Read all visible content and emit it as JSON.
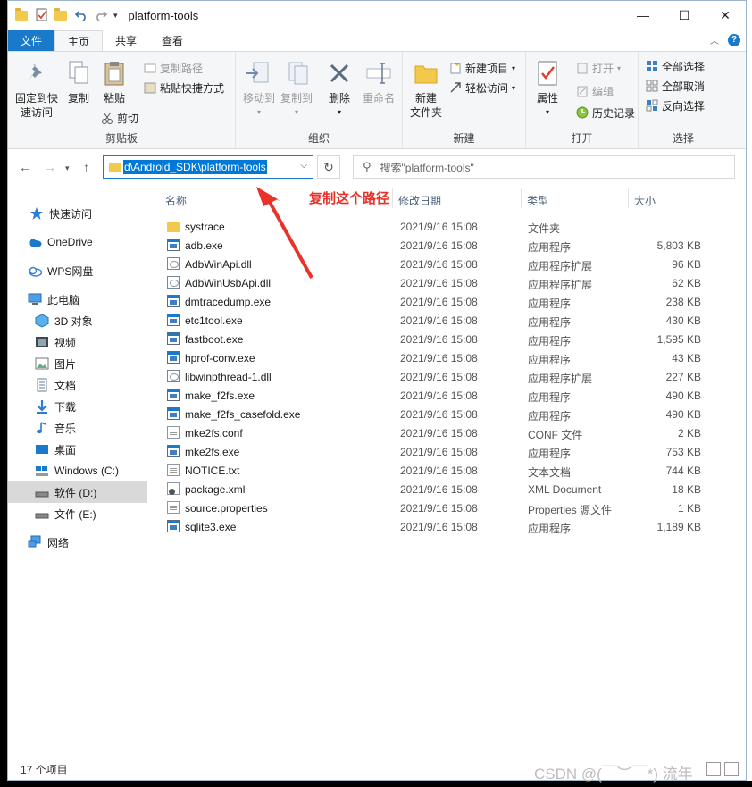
{
  "window": {
    "title": "platform-tools",
    "controls": [
      "—",
      "☐",
      "✕"
    ]
  },
  "ribbon_tabs": [
    "文件",
    "主页",
    "共享",
    "查看"
  ],
  "ribbon": {
    "clipboard": {
      "caption": "剪贴板",
      "pin": "固定到快速访问",
      "pin_line1": "固定到快",
      "pin_line2": "速访问",
      "copy": "复制",
      "paste": "粘贴",
      "copy_path": "复制路径",
      "paste_shortcut": "粘贴快捷方式",
      "cut": "剪切"
    },
    "organize": {
      "caption": "组织",
      "move_to": "移动到",
      "copy_to": "复制到",
      "delete": "删除",
      "rename": "重命名"
    },
    "new": {
      "caption": "新建",
      "new_folder_line1": "新建",
      "new_folder_line2": "文件夹",
      "new_item": "新建项目",
      "easy_access": "轻松访问"
    },
    "open": {
      "caption": "打开",
      "properties": "属性",
      "open": "打开",
      "edit": "编辑",
      "history": "历史记录"
    },
    "select": {
      "caption": "选择",
      "select_all": "全部选择",
      "select_none": "全部取消",
      "invert": "反向选择"
    }
  },
  "address": {
    "path": "d\\Android_SDK\\platform-tools",
    "search_placeholder": "搜索\"platform-tools\""
  },
  "annotation": "复制这个路径",
  "sidebar": {
    "items": [
      {
        "label": "快速访问",
        "icon": "star-icon"
      },
      {
        "label": "OneDrive",
        "icon": "cloud-icon"
      },
      {
        "label": "WPS网盘",
        "icon": "wps-cloud-icon"
      },
      {
        "label": "此电脑",
        "icon": "computer-icon"
      },
      {
        "label": "3D 对象",
        "icon": "cube-icon"
      },
      {
        "label": "视频",
        "icon": "video-icon"
      },
      {
        "label": "图片",
        "icon": "picture-icon"
      },
      {
        "label": "文档",
        "icon": "document-icon"
      },
      {
        "label": "下载",
        "icon": "download-icon"
      },
      {
        "label": "音乐",
        "icon": "music-icon"
      },
      {
        "label": "桌面",
        "icon": "desktop-icon"
      },
      {
        "label": "Windows (C:)",
        "icon": "drive-c-icon"
      },
      {
        "label": "软件 (D:)",
        "icon": "drive-icon"
      },
      {
        "label": "文件 (E:)",
        "icon": "drive-icon"
      },
      {
        "label": "网络",
        "icon": "network-icon"
      }
    ]
  },
  "columns": {
    "name": "名称",
    "date": "修改日期",
    "type": "类型",
    "size": "大小"
  },
  "files": [
    {
      "name": "systrace",
      "date": "2021/9/16 15:08",
      "type": "文件夹",
      "size": "",
      "icon": "folder"
    },
    {
      "name": "adb.exe",
      "date": "2021/9/16 15:08",
      "type": "应用程序",
      "size": "5,803 KB",
      "icon": "exe"
    },
    {
      "name": "AdbWinApi.dll",
      "date": "2021/9/16 15:08",
      "type": "应用程序扩展",
      "size": "96 KB",
      "icon": "dll"
    },
    {
      "name": "AdbWinUsbApi.dll",
      "date": "2021/9/16 15:08",
      "type": "应用程序扩展",
      "size": "62 KB",
      "icon": "dll"
    },
    {
      "name": "dmtracedump.exe",
      "date": "2021/9/16 15:08",
      "type": "应用程序",
      "size": "238 KB",
      "icon": "exe"
    },
    {
      "name": "etc1tool.exe",
      "date": "2021/9/16 15:08",
      "type": "应用程序",
      "size": "430 KB",
      "icon": "exe"
    },
    {
      "name": "fastboot.exe",
      "date": "2021/9/16 15:08",
      "type": "应用程序",
      "size": "1,595 KB",
      "icon": "exe"
    },
    {
      "name": "hprof-conv.exe",
      "date": "2021/9/16 15:08",
      "type": "应用程序",
      "size": "43 KB",
      "icon": "exe"
    },
    {
      "name": "libwinpthread-1.dll",
      "date": "2021/9/16 15:08",
      "type": "应用程序扩展",
      "size": "227 KB",
      "icon": "dll"
    },
    {
      "name": "make_f2fs.exe",
      "date": "2021/9/16 15:08",
      "type": "应用程序",
      "size": "490 KB",
      "icon": "exe"
    },
    {
      "name": "make_f2fs_casefold.exe",
      "date": "2021/9/16 15:08",
      "type": "应用程序",
      "size": "490 KB",
      "icon": "exe"
    },
    {
      "name": "mke2fs.conf",
      "date": "2021/9/16 15:08",
      "type": "CONF 文件",
      "size": "2 KB",
      "icon": "doc"
    },
    {
      "name": "mke2fs.exe",
      "date": "2021/9/16 15:08",
      "type": "应用程序",
      "size": "753 KB",
      "icon": "exe"
    },
    {
      "name": "NOTICE.txt",
      "date": "2021/9/16 15:08",
      "type": "文本文档",
      "size": "744 KB",
      "icon": "doc"
    },
    {
      "name": "package.xml",
      "date": "2021/9/16 15:08",
      "type": "XML Document",
      "size": "18 KB",
      "icon": "xml"
    },
    {
      "name": "source.properties",
      "date": "2021/9/16 15:08",
      "type": "Properties 源文件",
      "size": "1 KB",
      "icon": "doc"
    },
    {
      "name": "sqlite3.exe",
      "date": "2021/9/16 15:08",
      "type": "应用程序",
      "size": "1,189 KB",
      "icon": "exe"
    }
  ],
  "status": {
    "count": "17 个项目"
  },
  "watermark": "CSDN @(￣︶￣*) 流年",
  "colors": {
    "accent": "#1979ca",
    "selection": "#0078d7",
    "annotation": "#e8322a",
    "folder": "#f2c94c"
  }
}
